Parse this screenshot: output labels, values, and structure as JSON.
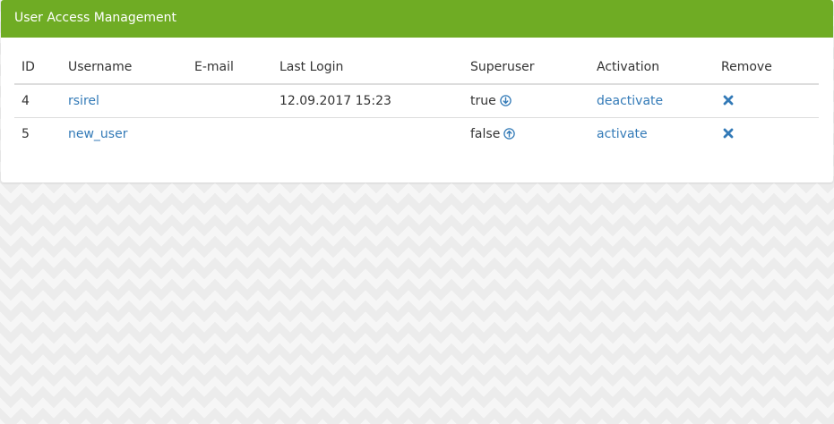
{
  "panel": {
    "title": "User Access Management",
    "header_color": "#6fac24"
  },
  "table": {
    "headers": {
      "id": "ID",
      "username": "Username",
      "email": "E-mail",
      "last_login": "Last Login",
      "superuser": "Superuser",
      "activation": "Activation",
      "remove": "Remove"
    },
    "rows": [
      {
        "id": "4",
        "username": "rsirel",
        "email": "",
        "last_login": "12.09.2017 15:23",
        "superuser": "true",
        "superuser_icon": "arrow-circle-down-icon",
        "activation": "deactivate",
        "remove_icon": "remove-x-icon"
      },
      {
        "id": "5",
        "username": "new_user",
        "email": "",
        "last_login": "",
        "superuser": "false",
        "superuser_icon": "arrow-circle-up-icon",
        "activation": "activate",
        "remove_icon": "remove-x-icon"
      }
    ]
  },
  "colors": {
    "link": "#337ab7",
    "text": "#333333"
  }
}
